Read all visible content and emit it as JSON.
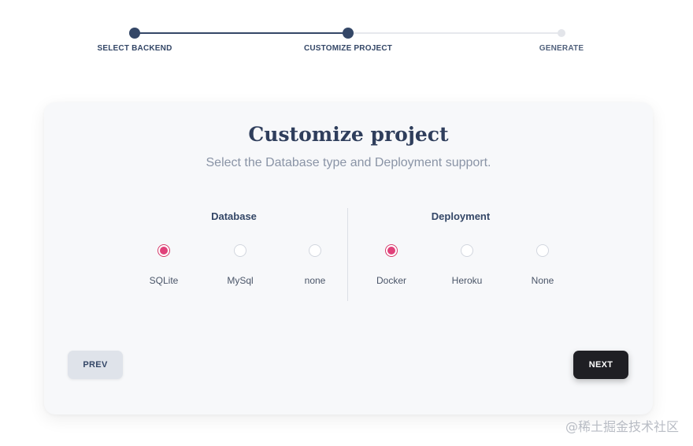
{
  "stepper": {
    "steps": [
      {
        "label": "SELECT BACKEND",
        "state": "done"
      },
      {
        "label": "CUSTOMIZE PROJECT",
        "state": "current"
      },
      {
        "label": "GENERATE",
        "state": "todo"
      }
    ],
    "colors": {
      "active": "#344767",
      "inactive": "#e3e5ea"
    }
  },
  "card": {
    "title": "Customize project",
    "subtitle": "Select the Database type and Deployment support."
  },
  "database": {
    "title": "Database",
    "options": [
      {
        "label": "SQLite",
        "checked": true
      },
      {
        "label": "MySql",
        "checked": false
      },
      {
        "label": "none",
        "checked": false
      }
    ]
  },
  "deployment": {
    "title": "Deployment",
    "options": [
      {
        "label": "Docker",
        "checked": true
      },
      {
        "label": "Heroku",
        "checked": false
      },
      {
        "label": "None",
        "checked": false
      }
    ]
  },
  "buttons": {
    "prev": "PREV",
    "next": "NEXT"
  },
  "accent_color": "#e0417a",
  "watermark": "@稀土掘金技术社区"
}
